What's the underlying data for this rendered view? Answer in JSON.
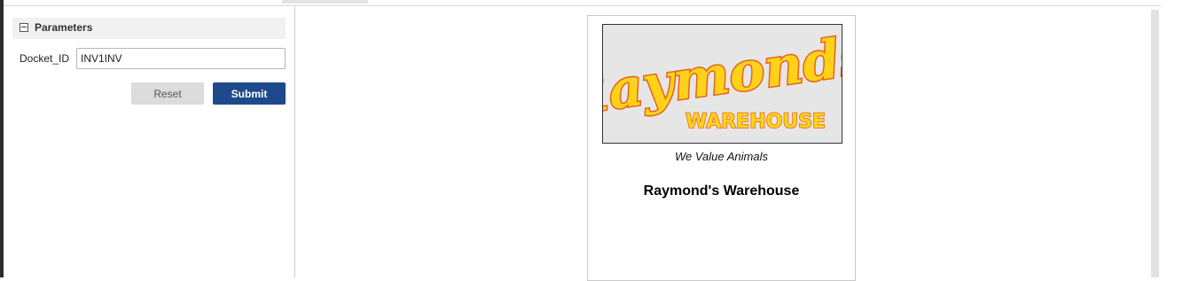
{
  "parameters": {
    "header": "Parameters",
    "fields": [
      {
        "label": "Docket_ID",
        "value": "INV1INV"
      }
    ],
    "reset_label": "Reset",
    "submit_label": "Submit"
  },
  "report": {
    "logo": {
      "script_text": "Raymonds",
      "sub_text": "WAREHOUSE",
      "fill_color": "#ffd21a",
      "outline_color": "#e8621c"
    },
    "tagline": "We Value Animals",
    "company_name": "Raymond's Warehouse"
  }
}
